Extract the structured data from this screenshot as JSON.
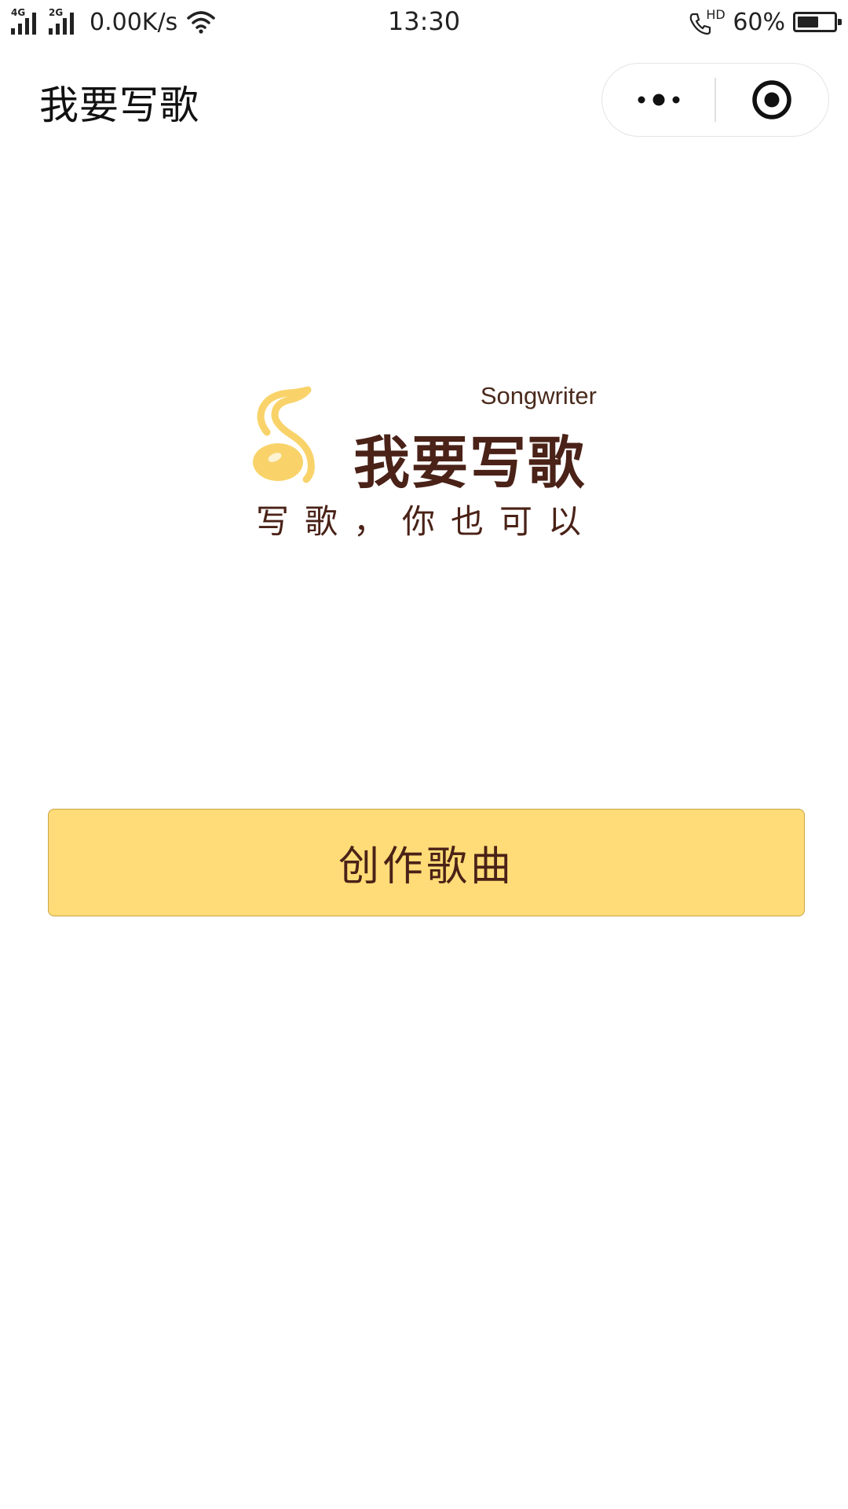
{
  "status_bar": {
    "net_type_1": "4G",
    "net_type_2": "2G",
    "net_speed": "0.00K/s",
    "time": "13:30",
    "call_badge": "HD",
    "battery_percent": "60%",
    "battery_level": 0.6
  },
  "nav": {
    "title": "我要写歌"
  },
  "logo": {
    "subtitle": "Songwriter",
    "name": "我要写歌",
    "slogan": "写歌，你也可以"
  },
  "main": {
    "create_button_label": "创作歌曲"
  },
  "colors": {
    "accent_yellow": "#ffdc78",
    "brand_brown": "#4a2217",
    "logo_yellow": "#f9d36a"
  }
}
